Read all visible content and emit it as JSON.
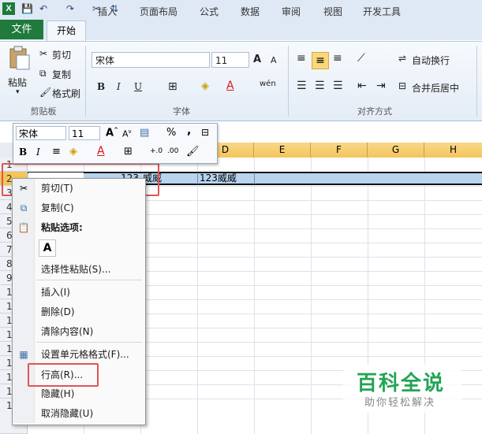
{
  "titlebar": {
    "logo": "X",
    "qa_save": "💾",
    "qa_undo": "↶",
    "qa_redo": "↷",
    "qa_tool": "✂",
    "qa_more": "⇅"
  },
  "tabs": [
    {
      "label": "文件"
    },
    {
      "label": "开始"
    },
    {
      "label": "插入"
    },
    {
      "label": "页面布局"
    },
    {
      "label": "公式"
    },
    {
      "label": "数据"
    },
    {
      "label": "审阅"
    },
    {
      "label": "视图"
    },
    {
      "label": "开发工具"
    }
  ],
  "ribbon": {
    "paste_label": "粘贴",
    "cut_label": "剪切",
    "copy_label": "复制",
    "format_painter_label": "格式刷",
    "clipboard_group": "剪贴板",
    "font_name": "宋体",
    "font_size": "11",
    "font_group": "字体",
    "wrap_label": "自动换行",
    "merge_label": "合并后居中",
    "align_group": "对齐方式",
    "bold": "B",
    "italic": "I",
    "underline": "U",
    "grow": "A",
    "shrink": "A",
    "wen": "wén"
  },
  "mini_toolbar": {
    "font_name": "宋体",
    "font_size": "11",
    "percent": "%",
    "comma": ",",
    "bold": "B",
    "italic": "I",
    "inc_dec": "+.0",
    "dec_dec": ".00"
  },
  "columns": [
    "D",
    "E",
    "F",
    "G",
    "H"
  ],
  "rows": [
    "1",
    "2",
    "3",
    "4",
    "5",
    "6",
    "7",
    "8",
    "9",
    "1",
    "1",
    "1",
    "1",
    "1",
    "1",
    "1",
    "1",
    "1"
  ],
  "cells": {
    "b2": "123",
    "c2": "威威",
    "d2": "123威威"
  },
  "context_menu": {
    "cut": "剪切(T)",
    "copy": "复制(C)",
    "paste_options": "粘贴选项:",
    "paste_a": "A",
    "paste_special": "选择性粘贴(S)...",
    "insert": "插入(I)",
    "delete": "删除(D)",
    "clear": "清除内容(N)",
    "format_cells": "设置单元格格式(F)...",
    "row_height": "行高(R)...",
    "hide": "隐藏(H)",
    "unhide": "取消隐藏(U)"
  },
  "watermark": {
    "title": "百科全说",
    "subtitle": "助你轻松解决"
  },
  "colors": {
    "accent_green": "#1f7a3b",
    "highlight": "#e15454",
    "selected_row": "#b8d4ef",
    "col_header": "#f5c55a"
  }
}
